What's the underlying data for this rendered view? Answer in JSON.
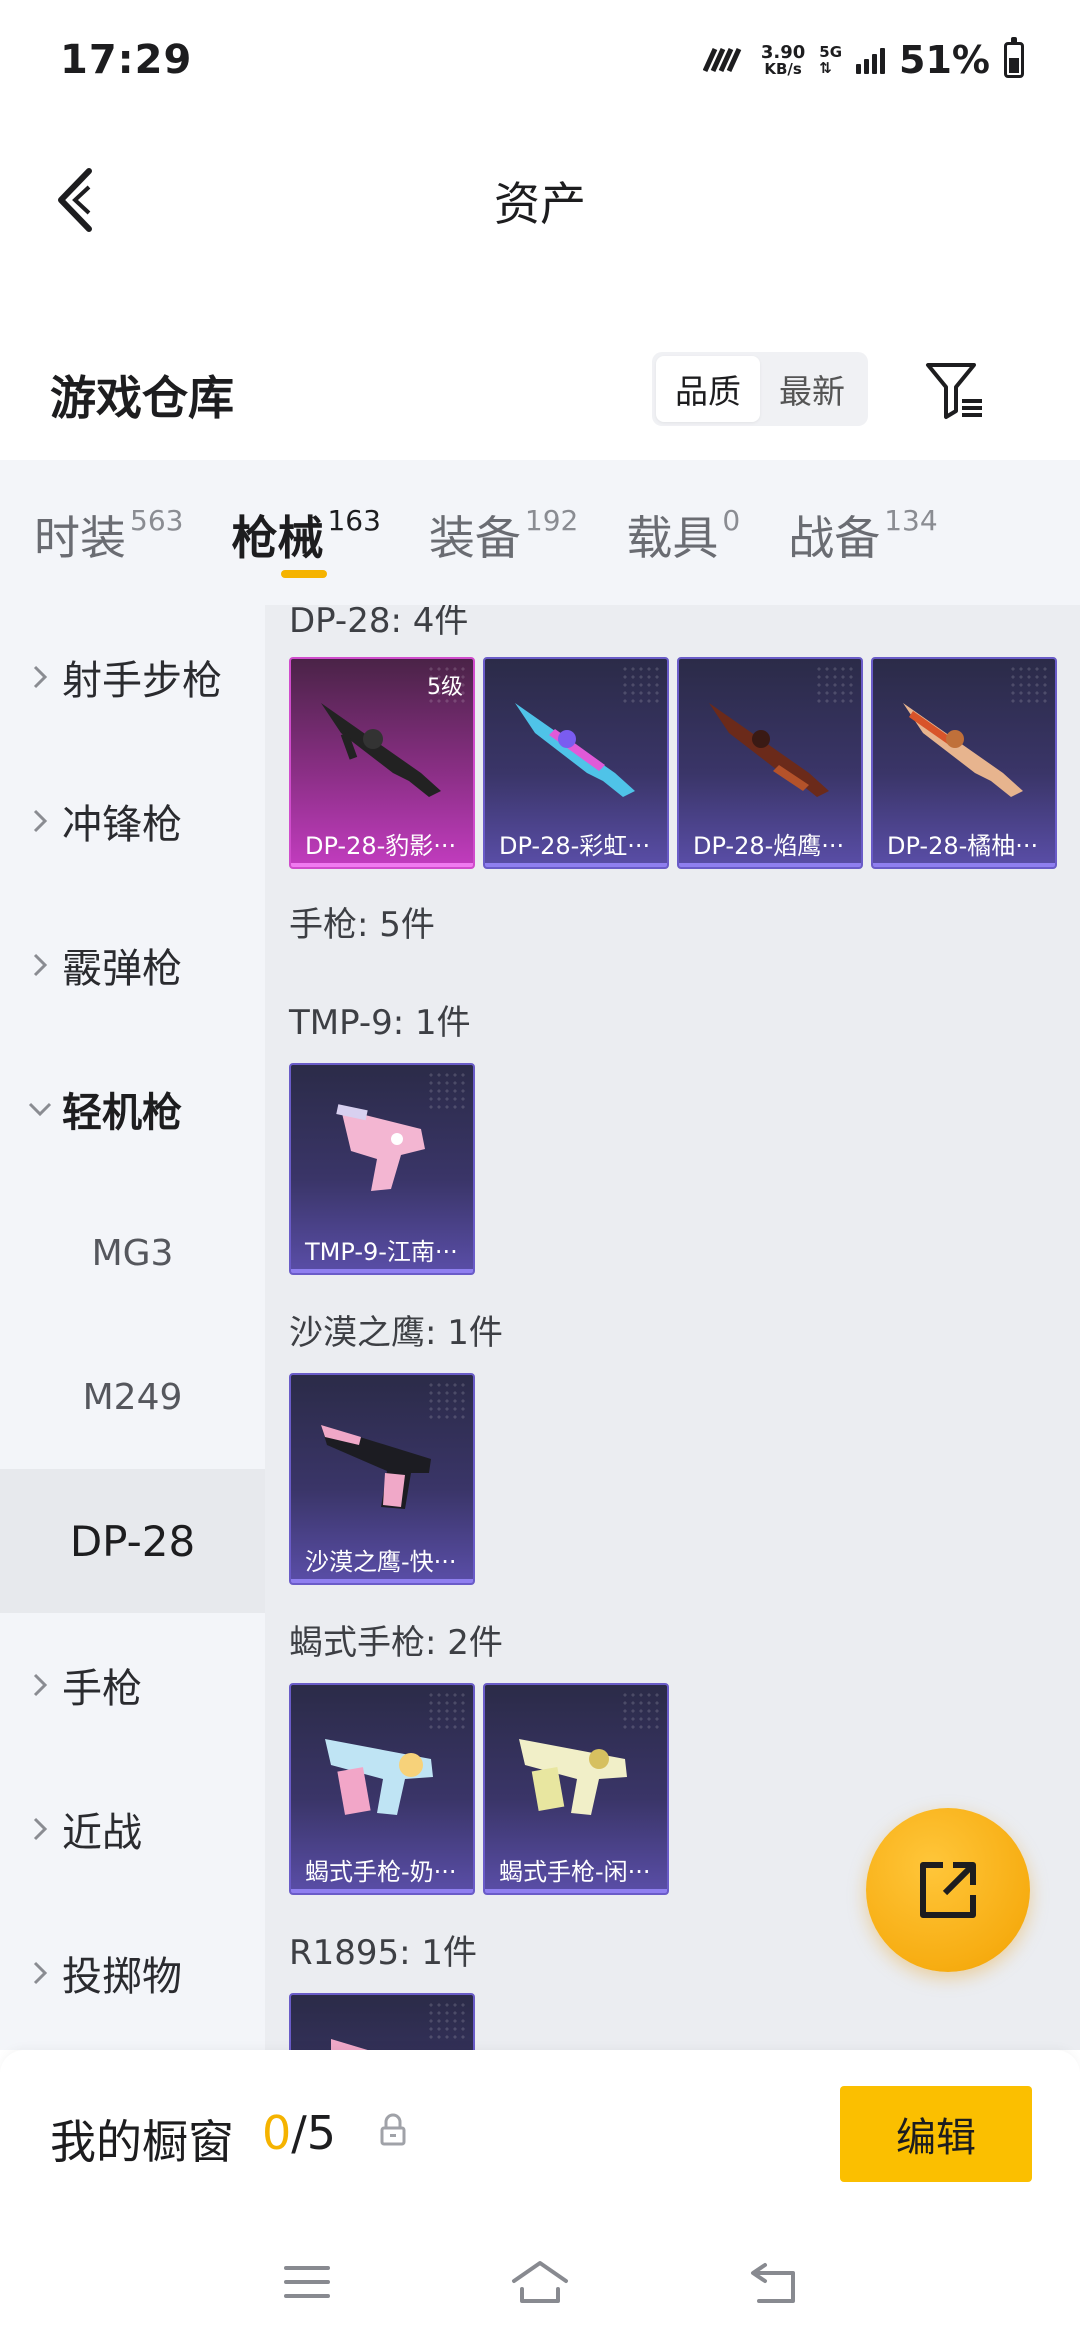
{
  "status_bar": {
    "time": "17:29",
    "net_speed_value": "3.90",
    "net_speed_unit": "KB/s",
    "network_type": "5G",
    "battery_percent": "51%"
  },
  "header": {
    "title": "资产",
    "back_icon": "chevron-left-icon"
  },
  "warehouse": {
    "title": "游戏仓库",
    "sort_options": [
      "品质",
      "最新"
    ],
    "sort_selected": "品质",
    "filter_icon": "filter-icon"
  },
  "category_tabs": [
    {
      "label": "时装",
      "count": "563",
      "active": false
    },
    {
      "label": "枪械",
      "count": "163",
      "active": true
    },
    {
      "label": "装备",
      "count": "192",
      "active": false
    },
    {
      "label": "载具",
      "count": "0",
      "active": false
    },
    {
      "label": "战备",
      "count": "134",
      "active": false
    }
  ],
  "sidebar": {
    "items": [
      {
        "label": "射手步枪",
        "expanded": false
      },
      {
        "label": "冲锋枪",
        "expanded": false
      },
      {
        "label": "霰弹枪",
        "expanded": false
      },
      {
        "label": "轻机枪",
        "expanded": true
      },
      {
        "label": "手枪",
        "expanded": false
      },
      {
        "label": "近战",
        "expanded": false
      },
      {
        "label": "投掷物",
        "expanded": false
      }
    ],
    "subitems": [
      {
        "label": "MG3",
        "selected": false
      },
      {
        "label": "M249",
        "selected": false
      },
      {
        "label": "DP-28",
        "selected": true
      }
    ]
  },
  "content": {
    "groups": [
      {
        "title": "DP-28: 4件"
      },
      {
        "title": "手枪: 5件"
      },
      {
        "title": "TMP-9: 1件"
      },
      {
        "title": "沙漠之鹰: 1件"
      },
      {
        "title": "蝎式手枪: 2件"
      },
      {
        "title": "R1895: 1件"
      }
    ],
    "cards": [
      {
        "name": "DP-28-豹影···",
        "level": "5级",
        "rarity": "magenta"
      },
      {
        "name": "DP-28-彩虹···",
        "level": "",
        "rarity": "purple"
      },
      {
        "name": "DP-28-焰鹰···",
        "level": "",
        "rarity": "purple"
      },
      {
        "name": "DP-28-橘柚···",
        "level": "",
        "rarity": "purple"
      },
      {
        "name": "TMP-9-江南···",
        "level": "",
        "rarity": "purple"
      },
      {
        "name": "沙漠之鹰-快···",
        "level": "",
        "rarity": "purple"
      },
      {
        "name": "蝎式手枪-奶···",
        "level": "",
        "rarity": "purple"
      },
      {
        "name": "蝎式手枪-闲···",
        "level": "",
        "rarity": "purple"
      },
      {
        "name": "",
        "level": "",
        "rarity": "purple"
      }
    ],
    "fab_icon": "share-external-icon"
  },
  "showcase": {
    "title": "我的橱窗",
    "count_current": "0",
    "count_sep_total": "/5",
    "lock_icon": "lock-icon",
    "edit_label": "编辑"
  },
  "nav": {
    "menu_icon": "menu-icon",
    "home_icon": "home-icon",
    "back_icon": "back-icon"
  },
  "colors": {
    "accent": "#f5b300",
    "edit_button": "#fbbf00",
    "card_purple": "#5a4ea8",
    "card_magenta": "#c23cbf"
  }
}
